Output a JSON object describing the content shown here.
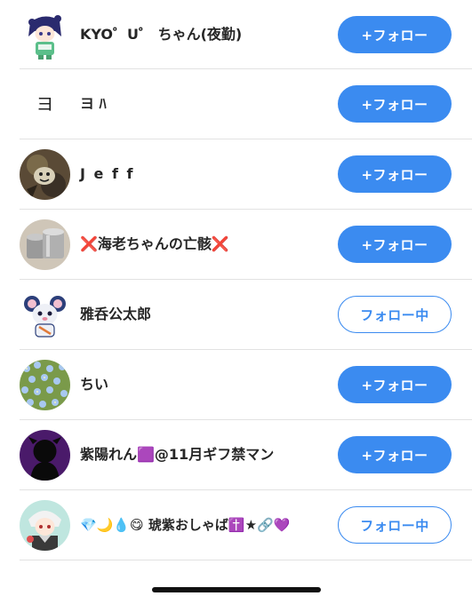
{
  "users": [
    {
      "name": "KYO゜U゜ ちゃん(夜勤)",
      "button": "+フォロー",
      "state": "follow",
      "avatar": "anime-girl-avatar"
    },
    {
      "name": "ヨ ﾊ",
      "button": "+フォロー",
      "state": "follow",
      "avatar": "text-avatar"
    },
    {
      "name": "J e f f",
      "button": "+フォロー",
      "state": "follow",
      "avatar": "dark-illustration-avatar"
    },
    {
      "name": "❌海老ちゃんの亡骸❌",
      "button": "+フォロー",
      "state": "follow",
      "avatar": "metal-cans-avatar"
    },
    {
      "name": "雅呑公太郎",
      "button": "フォロー中",
      "state": "following",
      "avatar": "mouse-mascot-avatar"
    },
    {
      "name": "ちい",
      "button": "+フォロー",
      "state": "follow",
      "avatar": "blue-flowers-avatar"
    },
    {
      "name": "紫陽れん🟪@11月ギフ禁マン",
      "button": "+フォロー",
      "state": "follow",
      "avatar": "silhouette-avatar"
    },
    {
      "name": "💎🌙💧😋 琥紫おしゃば✝️★🔗💜",
      "button": "フォロー中",
      "state": "following",
      "avatar": "anime-boy-avatar"
    }
  ],
  "avatar_text": "ヨ",
  "colors": {
    "accent": "#3b8bf0",
    "divider": "#e2e2e2"
  }
}
